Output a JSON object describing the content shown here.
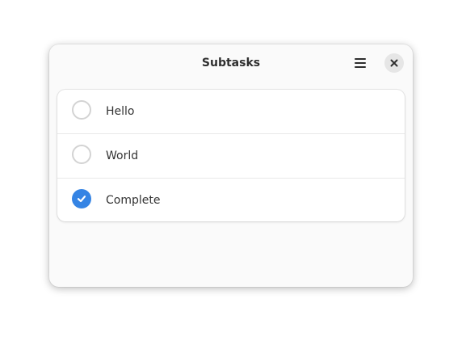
{
  "window": {
    "title": "Subtasks"
  },
  "header": {
    "menu_icon": "hamburger-menu-icon",
    "close_icon": "close-icon"
  },
  "subtasks": [
    {
      "label": "Hello",
      "checked": false
    },
    {
      "label": "World",
      "checked": false
    },
    {
      "label": "Complete",
      "checked": true
    }
  ],
  "colors": {
    "accent": "#3584e4",
    "window_bg": "#fafafa",
    "card_bg": "#ffffff",
    "unchecked_border": "#d3d3d3"
  }
}
